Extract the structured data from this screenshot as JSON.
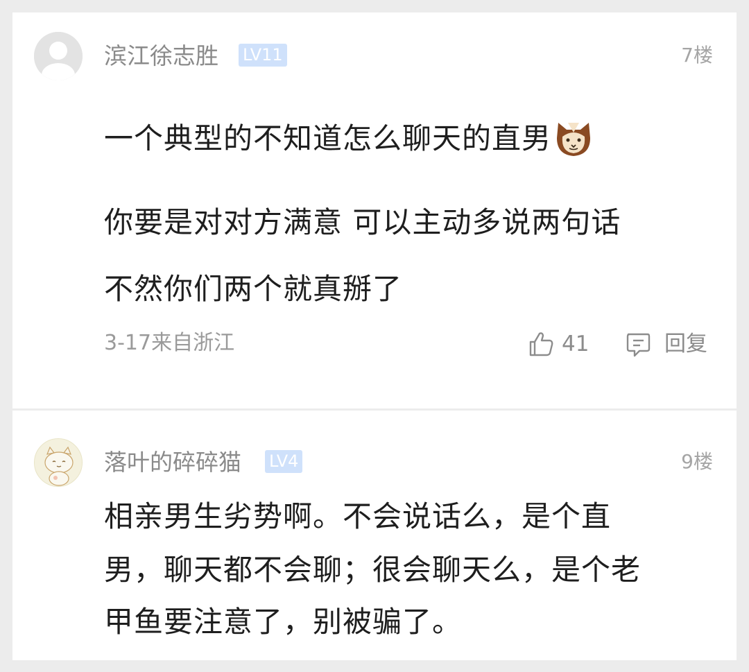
{
  "comments": [
    {
      "username": "滨江徐志胜",
      "level": "LV11",
      "floor": "7楼",
      "paragraphs": [
        "一个典型的不知道怎么聊天的直男",
        "你要是对对方满意 可以主动多说两句话",
        "不然你们两个就真掰了"
      ],
      "date_location": "3-17来自浙江",
      "likes": "41",
      "reply_label": "回复",
      "emoji": "cat-face-emoji"
    },
    {
      "username": "落叶的碎碎猫",
      "level": "LV4",
      "floor": "9楼",
      "paragraphs": [
        "相亲男生劣势啊。不会说话么，是个直",
        "男，聊天都不会聊；很会聊天么，是个老",
        "甲鱼要注意了，别被骗了。"
      ]
    }
  ],
  "colors": {
    "background": "#ececec",
    "card": "#ffffff",
    "level_badge": "#cfe1fb",
    "username": "#8a8a8a",
    "body_text": "#1e1e1e"
  }
}
